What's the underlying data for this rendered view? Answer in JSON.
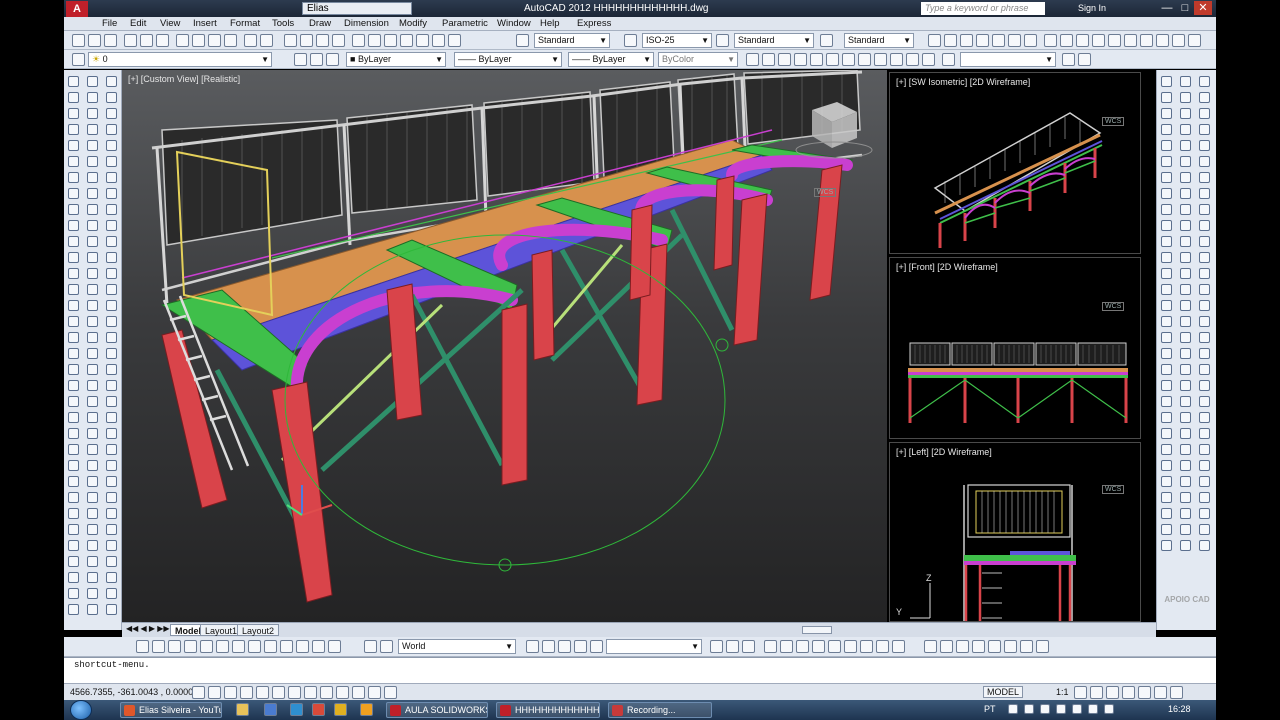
{
  "app": {
    "title": "AutoCAD 2012     HHHHHHHHHHHHH.dwg",
    "workspace": "Elias",
    "search_placeholder": "Type a keyword or phrase",
    "sign_in": "Sign In",
    "logo": "A"
  },
  "menu": [
    "File",
    "Edit",
    "View",
    "Insert",
    "Format",
    "Tools",
    "Draw",
    "Dimension",
    "Modify",
    "Parametric",
    "Window",
    "Help",
    "Express"
  ],
  "styles": {
    "text_style": "Standard",
    "dim_style": "ISO-25",
    "table_style": "Standard",
    "mleader_style": "Standard"
  },
  "properties": {
    "layer": "0",
    "color": "ByLayer",
    "linetype": "ByLayer",
    "lineweight": "ByLayer",
    "plotstyle": "ByColor"
  },
  "viewports": {
    "main_label": "[+] [Custom View] [Realistic]",
    "iso_label": "[+] [SW Isometric] [2D Wireframe]",
    "front_label": "[+] [Front] [2D Wireframe]",
    "left_label": "[+] [Left] [2D Wireframe]",
    "wcs": "WCS"
  },
  "tabs": [
    "Model",
    "Layout1",
    "Layout2"
  ],
  "ucs_combo": "World",
  "command_line": "shortcut-menu.",
  "status": {
    "coords": "4566.7355, -361.0043 , 0.0000",
    "model": "MODEL",
    "scale": "1:1"
  },
  "taskbar": {
    "items": [
      "Elias Silveira - YouTu...",
      "AULA SOLIDWORKS...",
      "HHHHHHHHHHHHH...",
      "Recording..."
    ],
    "lang": "PT",
    "clock": "16:28"
  },
  "watermark": "APOIO CAD",
  "colors": {
    "column": "#d9444a",
    "beam_green": "#3fbf4a",
    "beam_magenta": "#c93fd0",
    "deck_orange": "#d7914d",
    "deck_blue": "#5d53d9"
  }
}
